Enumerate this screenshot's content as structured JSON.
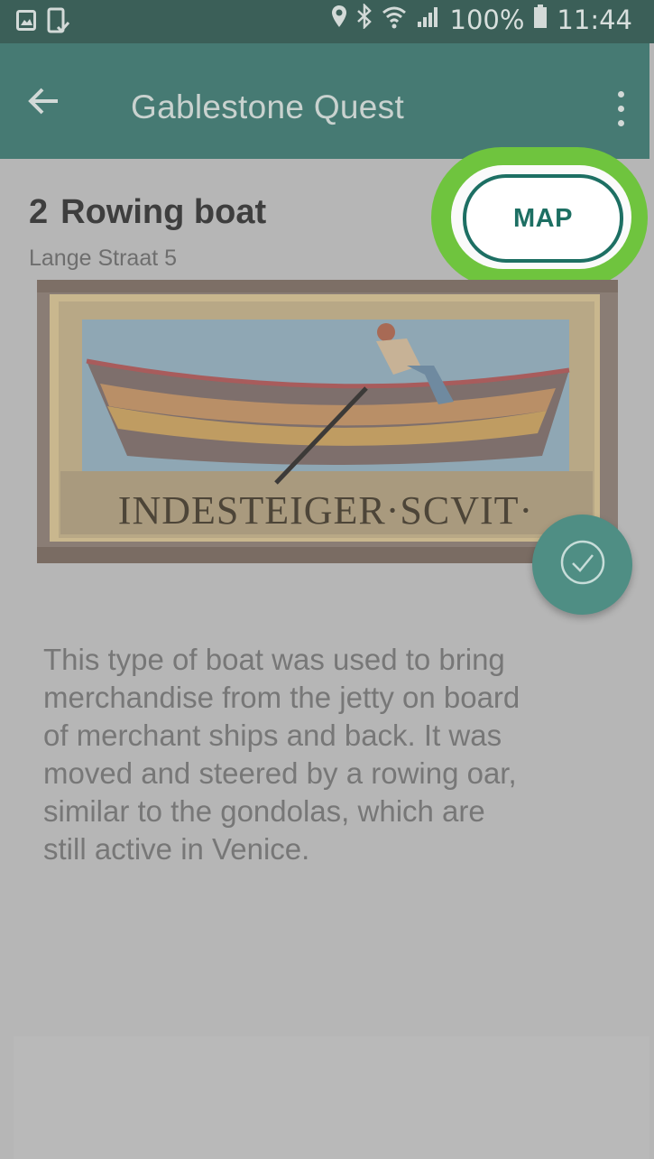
{
  "status_bar": {
    "battery_percent": "100%",
    "time": "11:44",
    "left_icons": [
      "image-icon",
      "phone-check-icon"
    ],
    "right_icons": [
      "location-pin-icon",
      "bluetooth-icon",
      "wifi-icon",
      "signal-icon",
      "battery-icon"
    ]
  },
  "app_bar": {
    "title": "Gablestone Quest",
    "back_icon": "arrow-left-icon",
    "overflow_icon": "more-vertical-icon"
  },
  "poi": {
    "number": "2",
    "name": "Rowing boat",
    "address": "Lange Straat 5",
    "map_button_label": "MAP",
    "image_inscription": "INDESTEIGER·SCVIT·",
    "description": "This type of boat was used to bring\nmerchandise from the jetty on board\nof merchant ships and back. It was\nmoved and steered by a rowing oar,\nsimilar to the gondolas, which are\nstill active in Venice."
  },
  "colors": {
    "status_bar": "#3b5f58",
    "app_bar": "#467a73",
    "accent": "#1d6f63",
    "highlight": "#6fc43e",
    "fab": "#4f8e84"
  }
}
